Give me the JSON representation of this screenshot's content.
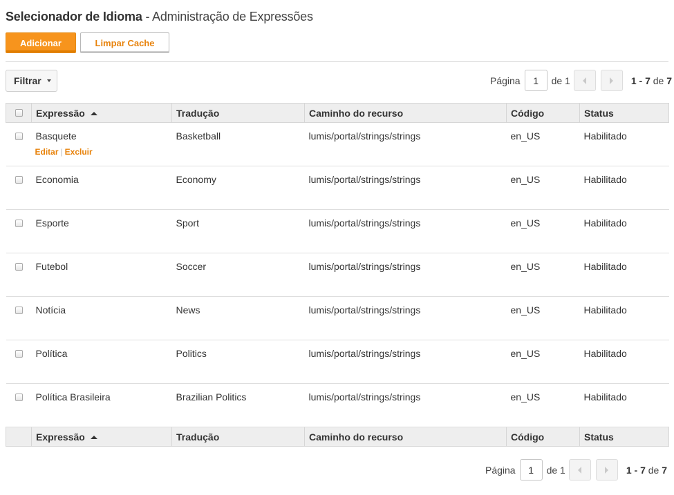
{
  "header": {
    "title_strong": "Selecionador de Idioma",
    "title_rest": " - Administração de Expressões"
  },
  "toolbar": {
    "add_label": "Adicionar",
    "clear_cache_label": "Limpar Cache",
    "filter_label": "Filtrar"
  },
  "pagination": {
    "page_label": "Página",
    "current_page": "1",
    "of_label": "de 1",
    "range": "1 - 7",
    "de": "de",
    "total": "7"
  },
  "table": {
    "columns": [
      "Expressão",
      "Tradução",
      "Caminho do recurso",
      "Código",
      "Status"
    ],
    "row_actions": {
      "edit": "Editar",
      "sep": "|",
      "delete": "Excluir"
    },
    "rows": [
      [
        "Basquete",
        "Basketball",
        "lumis/portal/strings/strings",
        "en_US",
        "Habilitado"
      ],
      [
        "Economia",
        "Economy",
        "lumis/portal/strings/strings",
        "en_US",
        "Habilitado"
      ],
      [
        "Esporte",
        "Sport",
        "lumis/portal/strings/strings",
        "en_US",
        "Habilitado"
      ],
      [
        "Futebol",
        "Soccer",
        "lumis/portal/strings/strings",
        "en_US",
        "Habilitado"
      ],
      [
        "Notícia",
        "News",
        "lumis/portal/strings/strings",
        "en_US",
        "Habilitado"
      ],
      [
        "Política",
        "Politics",
        "lumis/portal/strings/strings",
        "en_US",
        "Habilitado"
      ],
      [
        "Política Brasileira",
        "Brazilian Politics",
        "lumis/portal/strings/strings",
        "en_US",
        "Habilitado"
      ]
    ]
  },
  "colors": {
    "accent": "#f7941d",
    "link": "#e8830c",
    "header_bg": "#eeeeee"
  }
}
